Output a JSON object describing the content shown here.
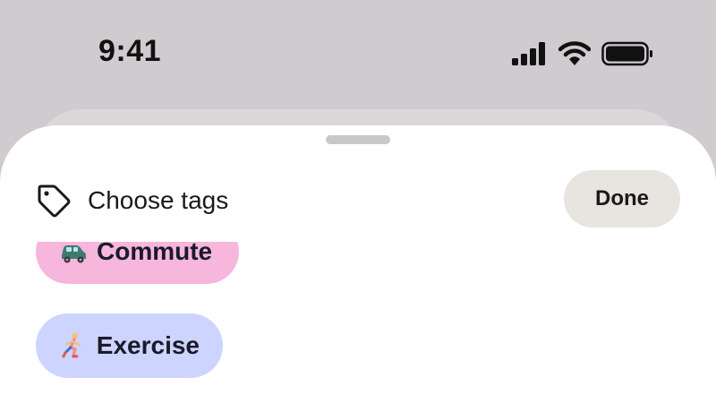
{
  "status_bar": {
    "time": "9:41",
    "icons": [
      "cellular-signal-icon",
      "wifi-icon",
      "battery-icon"
    ]
  },
  "sheet": {
    "title": "Choose tags",
    "title_icon": "tag-icon",
    "done_label": "Done"
  },
  "tags": [
    {
      "label": "Commute",
      "icon": "car-emoji-icon",
      "color": "#f7b6dc"
    },
    {
      "label": "Exercise",
      "icon": "runner-emoji-icon",
      "color": "#cdd4ff"
    }
  ],
  "colors": {
    "backdrop": "#cfcbcf",
    "sheet": "#ffffff",
    "done_button": "#e8e4df"
  }
}
